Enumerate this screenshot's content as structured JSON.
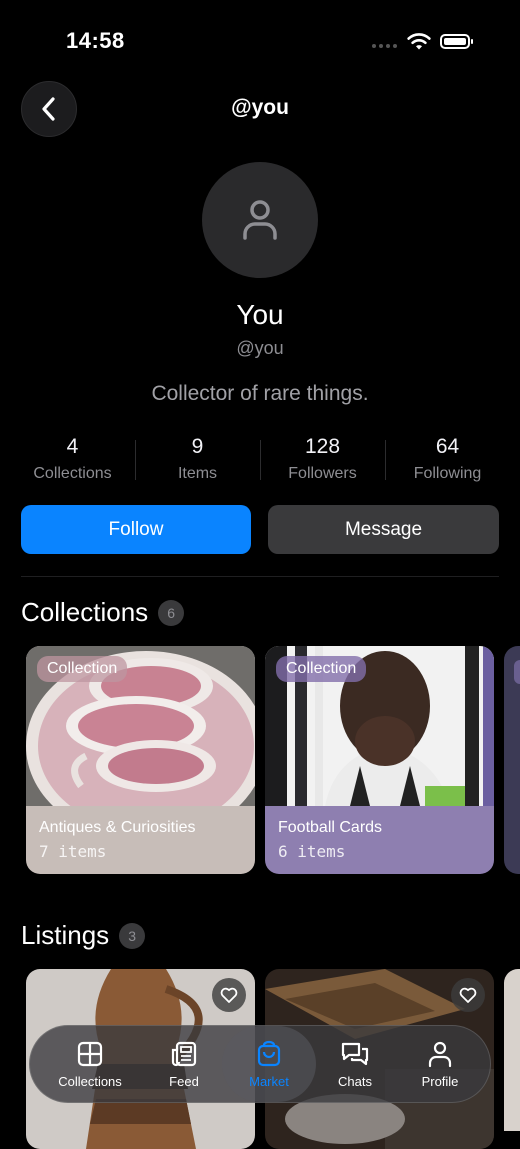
{
  "status_bar": {
    "time": "14:58"
  },
  "header": {
    "title": "@you"
  },
  "profile": {
    "name": "You",
    "handle": "@you",
    "bio": "Collector of rare things."
  },
  "stats": [
    {
      "value": "4",
      "label": "Collections"
    },
    {
      "value": "9",
      "label": "Items"
    },
    {
      "value": "128",
      "label": "Followers"
    },
    {
      "value": "64",
      "label": "Following"
    }
  ],
  "actions": {
    "follow_label": "Follow",
    "message_label": "Message"
  },
  "collections": {
    "title": "Collections",
    "count": "6",
    "items": [
      {
        "tag": "Collection",
        "name": "Antiques & Curiosities",
        "count": "7 items",
        "color": "#c7bdb8"
      },
      {
        "tag": "Collection",
        "name": "Football Cards",
        "count": "6 items",
        "color": "#8e7fb0"
      }
    ]
  },
  "listings": {
    "title": "Listings",
    "count": "3"
  },
  "tabbar": {
    "tabs": [
      {
        "label": "Collections",
        "icon": "grid-icon"
      },
      {
        "label": "Feed",
        "icon": "newspaper-icon"
      },
      {
        "label": "Market",
        "icon": "shopping-bag-icon",
        "active": true
      },
      {
        "label": "Chats",
        "icon": "chat-bubbles-icon"
      },
      {
        "label": "Profile",
        "icon": "person-icon"
      }
    ]
  },
  "colors": {
    "accent": "#0a84ff",
    "background": "#000000",
    "secondary_button": "#3a3a3c"
  }
}
